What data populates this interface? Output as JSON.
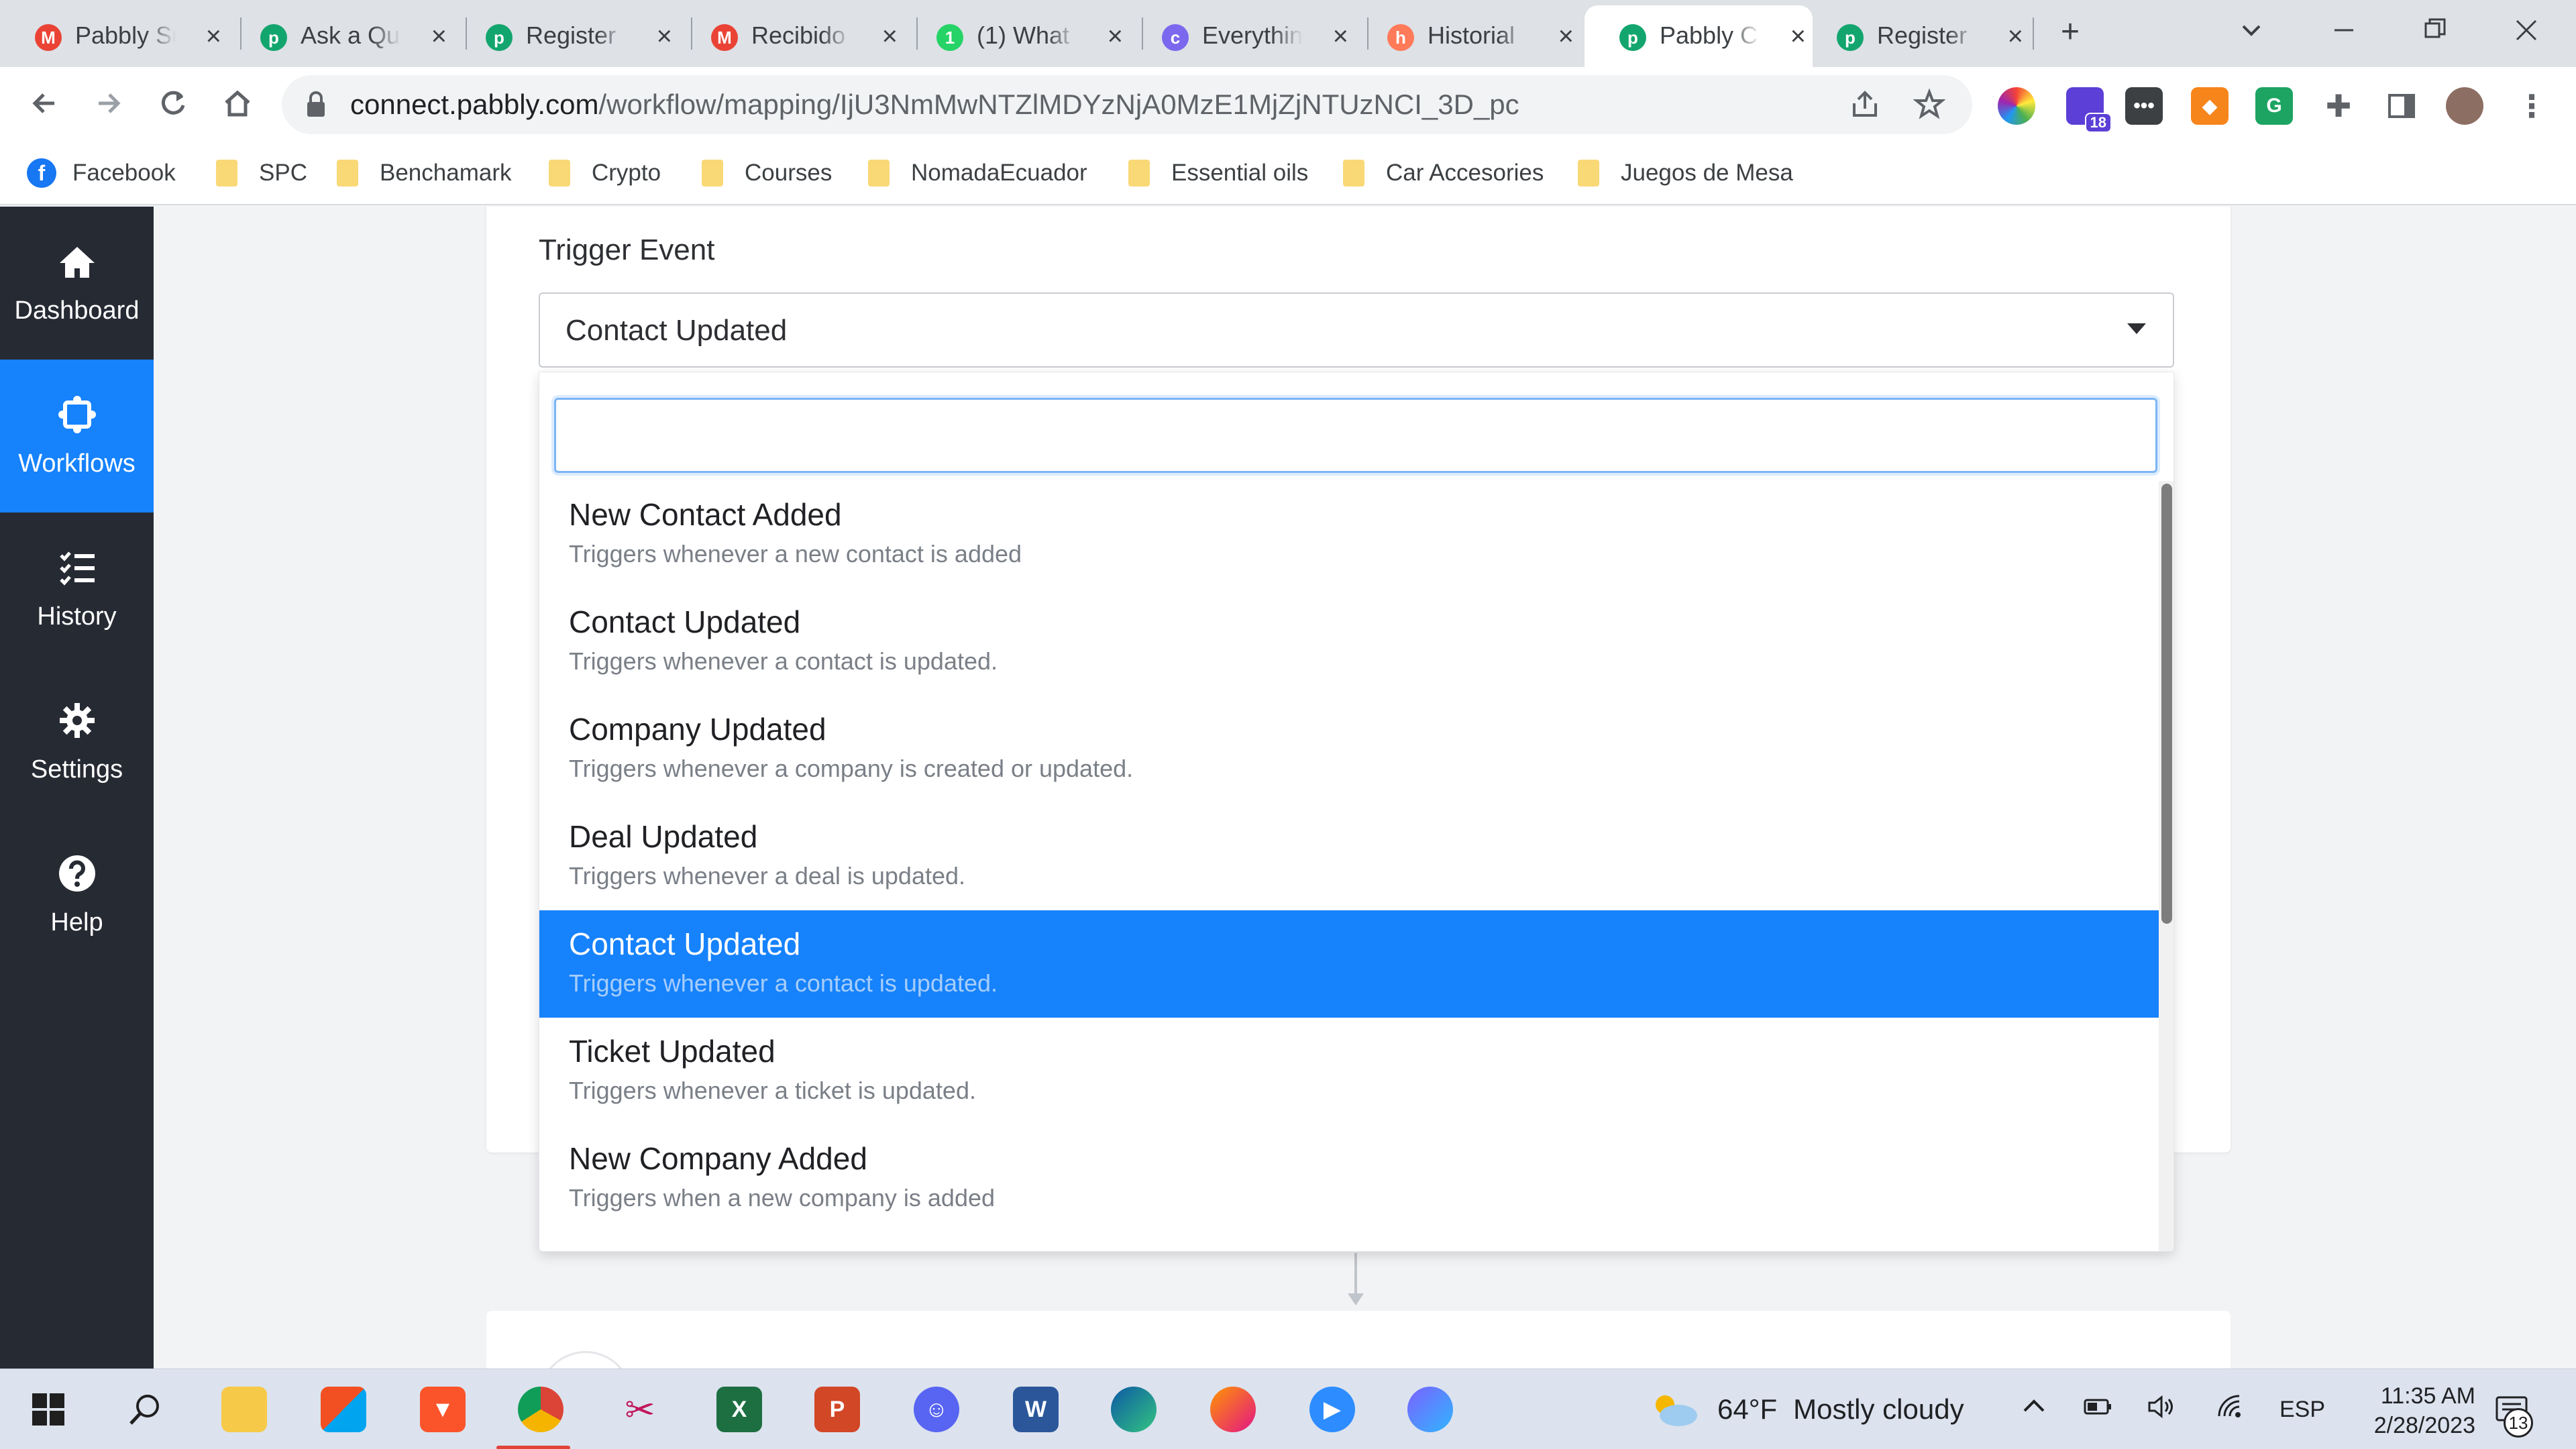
{
  "browser": {
    "tabs": [
      {
        "title": "Pabbly Su",
        "favicon": "gmail-icon",
        "color": "#ea4335",
        "active": false
      },
      {
        "title": "Ask a Qu",
        "favicon": "pabbly-icon",
        "color": "#13a56e",
        "active": false
      },
      {
        "title": "Register",
        "favicon": "pabbly-icon",
        "color": "#13a56e",
        "active": false
      },
      {
        "title": "Recibido",
        "favicon": "gmail-icon",
        "color": "#ea4335",
        "active": false
      },
      {
        "title": "(1) What",
        "favicon": "whatsapp-icon",
        "color": "#25d366",
        "active": false
      },
      {
        "title": "Everythin",
        "favicon": "clickup-icon",
        "color": "#7b68ee",
        "active": false
      },
      {
        "title": "Historial",
        "favicon": "hubspot-icon",
        "color": "#ff7a59",
        "active": false
      },
      {
        "title": "Pabbly C",
        "favicon": "pabbly-icon",
        "color": "#13a56e",
        "active": true
      },
      {
        "title": "Register",
        "favicon": "pabbly-icon",
        "color": "#13a56e",
        "active": false
      }
    ],
    "new_tab_icon": "plus-icon",
    "url": {
      "host": "connect.pabbly.com",
      "path": "/workflow/mapping/IjU3NmMwNTZlMDYzNjA0MzE1MjZjNTUzNCI_3D_pc"
    },
    "extension_badge": "18",
    "bookmarks": [
      "Facebook",
      "SPC",
      "Benchamark",
      "Crypto",
      "Courses",
      "NomadaEcuador",
      "Essential oils",
      "Car Accesories",
      "Juegos de Mesa"
    ]
  },
  "sidebar": {
    "items": [
      {
        "label": "Dashboard",
        "icon": "home-icon",
        "active": false
      },
      {
        "label": "Workflows",
        "icon": "workflow-icon",
        "active": true
      },
      {
        "label": "History",
        "icon": "list-check-icon",
        "active": false
      },
      {
        "label": "Settings",
        "icon": "gear-icon",
        "active": false
      },
      {
        "label": "Help",
        "icon": "help-circle-icon",
        "active": false
      }
    ]
  },
  "trigger": {
    "label": "Trigger Event",
    "selected_value": "Contact Updated",
    "search_placeholder": "",
    "options": [
      {
        "title": "New Contact Added",
        "description": "Triggers whenever a new contact is added",
        "selected": false
      },
      {
        "title": "Contact Updated",
        "description": "Triggers whenever a contact is updated.",
        "selected": false
      },
      {
        "title": "Company Updated",
        "description": "Triggers whenever a company is created or updated.",
        "selected": false
      },
      {
        "title": "Deal Updated",
        "description": "Triggers whenever a deal is updated.",
        "selected": false
      },
      {
        "title": "Contact Updated",
        "description": "Triggers whenever a contact is updated.",
        "selected": true
      },
      {
        "title": "Ticket Updated",
        "description": "Triggers whenever a ticket is updated.",
        "selected": false
      },
      {
        "title": "New Company Added",
        "description": "Triggers when a new company is added",
        "selected": false
      }
    ]
  },
  "taskbar": {
    "weather": {
      "temp": "64°F",
      "condition": "Mostly cloudy"
    },
    "language": "ESP",
    "time": "11:35 AM",
    "date": "2/28/2023",
    "notification_count": "13"
  },
  "colors": {
    "accent": "#1682fc",
    "sidebar_bg": "#262a33",
    "page_bg": "#f2f3f5"
  }
}
